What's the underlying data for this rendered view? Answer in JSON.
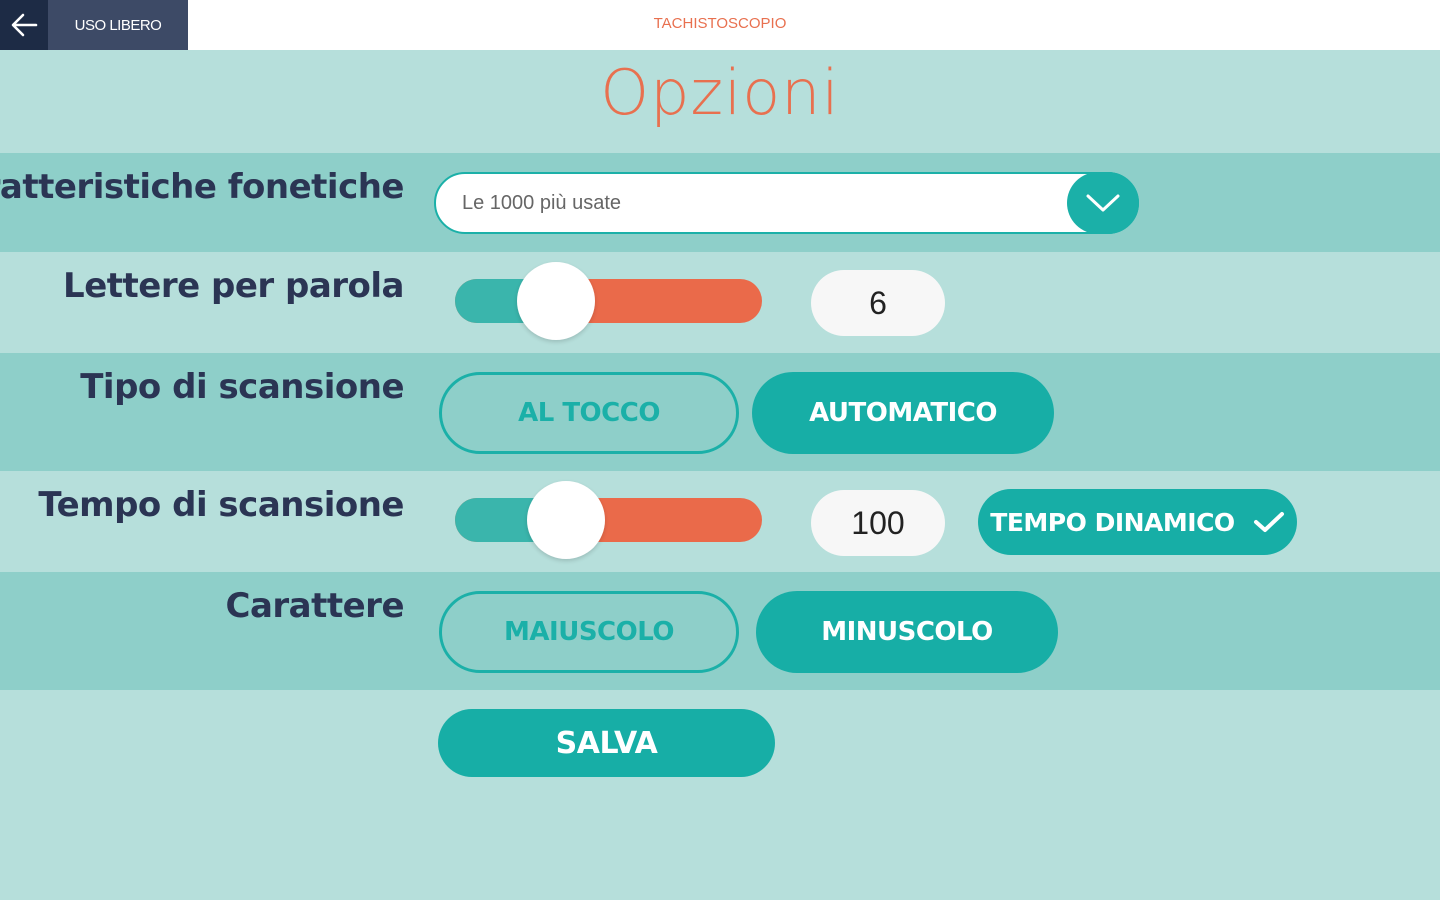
{
  "header": {
    "back_icon": "arrow-left-icon",
    "mode": "USO LIBERO",
    "app_title": "TACHISTOSCOPIO"
  },
  "page_title": "Opzioni",
  "colors": {
    "accent": "#1bb0a8",
    "title": "#e8704f",
    "slider_track": "#ea6a4a",
    "slider_fill": "#3ab5ac",
    "background": "#b6dfdb",
    "row_dark": "#8ecfc9",
    "header_dark": "#1d2b45"
  },
  "settings": {
    "phonetic": {
      "label": "Caratteristiche fonetiche",
      "selected": "Le 1000 più usate",
      "icon": "chevron-down-icon"
    },
    "letters": {
      "label": "Lettere per parola",
      "value": "6",
      "slider_fraction": 0.33
    },
    "scan_type": {
      "label": "Tipo di scansione",
      "options": [
        "AL TOCCO",
        "AUTOMATICO"
      ],
      "selected": "AUTOMATICO"
    },
    "scan_time": {
      "label": "Tempo di scansione",
      "value": "100",
      "slider_fraction": 0.36,
      "dynamic_label": "TEMPO DINAMICO",
      "dynamic_checked": true,
      "dynamic_icon": "checkmark-icon"
    },
    "case": {
      "label": "Carattere",
      "options": [
        "MAIUSCOLO",
        "MINUSCOLO"
      ],
      "selected": "MINUSCOLO"
    }
  },
  "save_label": "SALVA"
}
